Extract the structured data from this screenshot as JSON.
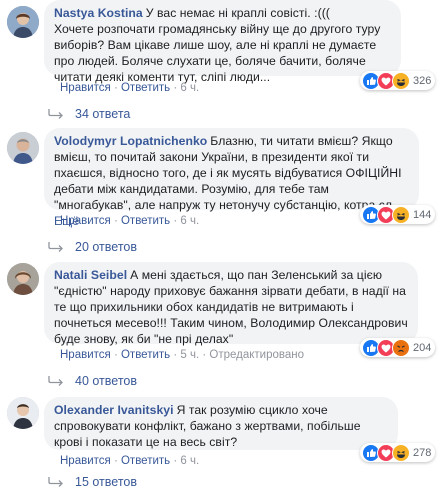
{
  "colors": {
    "link": "#385898",
    "bubble": "#f2f3f5",
    "meta": "#90949c",
    "like": "#1877f2",
    "love": "#f33e58",
    "haha": "#f7b125"
  },
  "comments": [
    {
      "author": "Nastya Kostina",
      "text": "У вас немає ні краплі совісті. :(((\nХочете розпочати громадянську війну ще до другого туру виборів? Вам цікаве лише шоу, але ні краплі не думаєте про людей. Боляче слухати це, боляче бачити, боляче читати деякі коменти тут, сліпі люди...",
      "more": "",
      "reactions": [
        "like-icon",
        "love-icon",
        "haha-icon"
      ],
      "reaction_count": "326",
      "actions": {
        "like": "Нравится",
        "reply": "Ответить",
        "time": "6 ч.",
        "edited": ""
      },
      "replies": "34 ответа"
    },
    {
      "author": "Volodymyr Lopatnichenko",
      "text": "Блазню, ти читати вмієш? Якщо вмієш, то почитай закони України, в президенти якої ти пхаєшся, відносно того, де і як мусять відбуватися ОФІЦІЙНІ дебати між кандидатами. Розумію, для тебе там \"многабукав\", але напруж ту нетонучу субстанцію, котра сл...",
      "more": "Ещё",
      "reactions": [
        "like-icon",
        "love-icon",
        "haha-icon"
      ],
      "reaction_count": "144",
      "actions": {
        "like": "Нравится",
        "reply": "Ответить",
        "time": "6 ч.",
        "edited": ""
      },
      "replies": "20 ответов"
    },
    {
      "author": "Natali Seibel",
      "text": "А мені здається, що пан Зеленський за цією \"єдністю\" народу приховує бажання зірвати дебати, в надії на те що прихильники обох кандидатів не витримають і почнеться месево!!! Таким чином, Володимир Олександрович буде знову, як би \"не прі делах\"",
      "more": "",
      "reactions": [
        "like-icon",
        "love-icon",
        "angry-icon"
      ],
      "reaction_count": "204",
      "actions": {
        "like": "Нравится",
        "reply": "Ответить",
        "time": "5 ч.",
        "edited": "Отредактировано"
      },
      "replies": "40 ответов"
    },
    {
      "author": "Olexander Ivanitskyi",
      "text": "Я так розумію сцикло хоче спровокувати конфлікт, бажано з жертвами, побільше крові і показати це на весь світ?",
      "more": "",
      "reactions": [
        "like-icon",
        "love-icon",
        "haha-icon"
      ],
      "reaction_count": "278",
      "actions": {
        "like": "Нравится",
        "reply": "Ответить",
        "time": "6 ч.",
        "edited": ""
      },
      "replies": "15 ответов"
    }
  ]
}
